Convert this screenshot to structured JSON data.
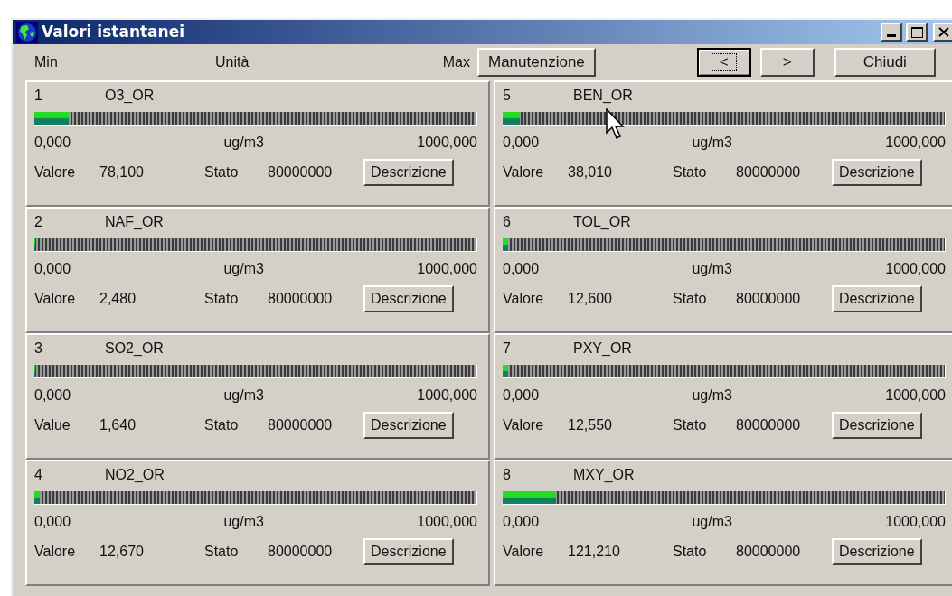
{
  "window": {
    "title": "Valori istantanei"
  },
  "header": {
    "min_label": "Min",
    "unit_label": "Unità",
    "max_label": "Max"
  },
  "buttons": [
    {
      "label": "Manutenzione",
      "kind": "wide",
      "focused": false
    },
    {
      "label": "<",
      "kind": "nav",
      "focused": true
    },
    {
      "label": ">",
      "kind": "nav",
      "focused": false
    },
    {
      "label": "Chiudi",
      "kind": "wide",
      "focused": false
    }
  ],
  "channels": [
    {
      "index": "1",
      "name": "O3_OR",
      "level": 0.0781,
      "min": "0,000",
      "unit": "ug/m3",
      "max": "1000,000",
      "value_label": "Valore",
      "value": "78,100",
      "state_label": "Stato",
      "state": "80000000",
      "button": "Descrizione"
    },
    {
      "index": "2",
      "name": "NAF_OR",
      "level": 0.00248,
      "min": "0,000",
      "unit": "ug/m3",
      "max": "1000,000",
      "value_label": "Valore",
      "value": "2,480",
      "state_label": "Stato",
      "state": "80000000",
      "button": "Descrizione"
    },
    {
      "index": "3",
      "name": "SO2_OR",
      "level": 0.00164,
      "min": "0,000",
      "unit": "ug/m3",
      "max": "1000,000",
      "value_label": "Value",
      "value": "1,640",
      "state_label": "Stato",
      "state": "80000000",
      "button": "Descrizione"
    },
    {
      "index": "4",
      "name": "NO2_OR",
      "level": 0.01267,
      "min": "0,000",
      "unit": "ug/m3",
      "max": "1000,000",
      "value_label": "Valore",
      "value": "12,670",
      "state_label": "Stato",
      "state": "80000000",
      "button": "Descrizione"
    },
    {
      "index": "5",
      "name": "BEN_OR",
      "level": 0.03801,
      "min": "0,000",
      "unit": "ug/m3",
      "max": "1000,000",
      "value_label": "Valore",
      "value": "38,010",
      "state_label": "Stato",
      "state": "80000000",
      "button": "Descrizione"
    },
    {
      "index": "6",
      "name": "TOL_OR",
      "level": 0.0126,
      "min": "0,000",
      "unit": "ug/m3",
      "max": "1000,000",
      "value_label": "Valore",
      "value": "12,600",
      "state_label": "Stato",
      "state": "80000000",
      "button": "Descrizione"
    },
    {
      "index": "7",
      "name": "PXY_OR",
      "level": 0.01255,
      "min": "0,000",
      "unit": "ug/m3",
      "max": "1000,000",
      "value_label": "Valore",
      "value": "12,550",
      "state_label": "Stato",
      "state": "80000000",
      "button": "Descrizione"
    },
    {
      "index": "8",
      "name": "MXY_OR",
      "level": 0.12121,
      "min": "0,000",
      "unit": "ug/m3",
      "max": "1000,000",
      "value_label": "Valore",
      "value": "121,210",
      "state_label": "Stato",
      "state": "80000000",
      "button": "Descrizione"
    }
  ]
}
